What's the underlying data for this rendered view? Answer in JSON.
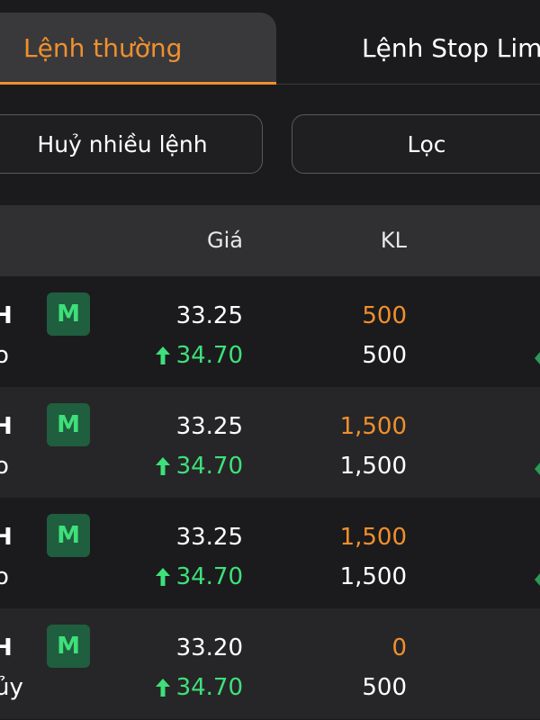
{
  "tabs": [
    {
      "label": "Lệnh thường",
      "active": true
    },
    {
      "label": "Lệnh Stop Limi",
      "active": false
    }
  ],
  "actions": {
    "cancel_many_label": "Huỷ nhiều lệnh",
    "filter_label": "Lọc"
  },
  "table": {
    "headers": {
      "price": "Giá",
      "quantity": "KL"
    },
    "rows": [
      {
        "symbol": "H",
        "status": "o",
        "badge": "M",
        "order_price": "33.25",
        "market_price": "34.70",
        "order_qty": "500",
        "matched_qty": "500"
      },
      {
        "symbol": "H",
        "status": "o",
        "badge": "M",
        "order_price": "33.25",
        "market_price": "34.70",
        "order_qty": "1,500",
        "matched_qty": "1,500"
      },
      {
        "symbol": "H",
        "status": "o",
        "badge": "M",
        "order_price": "33.25",
        "market_price": "34.70",
        "order_qty": "1,500",
        "matched_qty": "1,500"
      },
      {
        "symbol": "H",
        "status": "ủy",
        "badge": "M",
        "order_price": "33.20",
        "market_price": "34.70",
        "order_qty": "0",
        "matched_qty": "500"
      }
    ]
  },
  "colors": {
    "accent": "#f0902d",
    "up": "#3ee07a",
    "badge_bg": "#1f5e3e",
    "background": "#1b1b1d",
    "header_bg": "#303033"
  },
  "icons": {
    "price_trend": "arrow-up-icon"
  }
}
